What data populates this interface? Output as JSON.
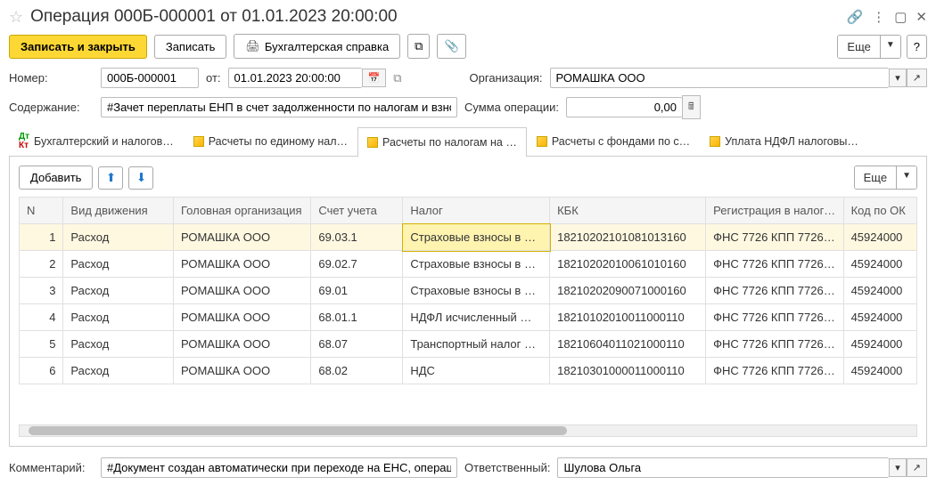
{
  "title": "Операция 000Б-000001 от 01.01.2023 20:00:00",
  "buttons": {
    "save_close": "Записать и закрыть",
    "save": "Записать",
    "print_doc": "Бухгалтерская справка",
    "more": "Еще"
  },
  "labels": {
    "number": "Номер:",
    "date_from": "от:",
    "organization": "Организация:",
    "content": "Содержание:",
    "op_sum": "Сумма операции:",
    "comment": "Комментарий:",
    "responsible": "Ответственный:"
  },
  "fields": {
    "number": "000Б-000001",
    "date": "01.01.2023 20:00:00",
    "organization": "РОМАШКА ООО",
    "content": "#Зачет переплаты ЕНП в счет задолженности по налогам и взноса",
    "op_sum": "0,00",
    "comment": "#Документ создан автоматически при переходе на ЕНС, операция",
    "responsible": "Шулова Ольга"
  },
  "tabs": [
    "Бухгалтерский и налогов…",
    "Расчеты по единому нал…",
    "Расчеты по налогам на …",
    "Расчеты с фондами по с…",
    "Уплата НДФЛ налоговы…"
  ],
  "active_tab": 2,
  "panel": {
    "add": "Добавить",
    "more": "Еще"
  },
  "columns": [
    "N",
    "Вид движения",
    "Головная организация",
    "Счет учета",
    "Налог",
    "КБК",
    "Регистрация в налого…",
    "Код по ОК"
  ],
  "rows": [
    {
      "n": "1",
      "move": "Расход",
      "org": "РОМАШКА ООО",
      "acct": "69.03.1",
      "tax": "Страховые взносы в …",
      "kbk": "18210202101081013160",
      "reg": "ФНС 7726 КПП 77260…",
      "code": "45924000"
    },
    {
      "n": "2",
      "move": "Расход",
      "org": "РОМАШКА ООО",
      "acct": "69.02.7",
      "tax": "Страховые взносы в …",
      "kbk": "18210202010061010160",
      "reg": "ФНС 7726 КПП 77260…",
      "code": "45924000"
    },
    {
      "n": "3",
      "move": "Расход",
      "org": "РОМАШКА ООО",
      "acct": "69.01",
      "tax": "Страховые взносы в …",
      "kbk": "18210202090071000160",
      "reg": "ФНС 7726 КПП 77260…",
      "code": "45924000"
    },
    {
      "n": "4",
      "move": "Расход",
      "org": "РОМАШКА ООО",
      "acct": "68.01.1",
      "tax": "НДФЛ исчисленный …",
      "kbk": "18210102010011000110",
      "reg": "ФНС 7726 КПП 77260…",
      "code": "45924000"
    },
    {
      "n": "5",
      "move": "Расход",
      "org": "РОМАШКА ООО",
      "acct": "68.07",
      "tax": "Транспортный налог …",
      "kbk": "18210604011021000110",
      "reg": "ФНС 7726 КПП 77260…",
      "code": "45924000"
    },
    {
      "n": "6",
      "move": "Расход",
      "org": "РОМАШКА ООО",
      "acct": "68.02",
      "tax": "НДС",
      "kbk": "18210301000011000110",
      "reg": "ФНС 7726 КПП 77260…",
      "code": "45924000"
    }
  ]
}
